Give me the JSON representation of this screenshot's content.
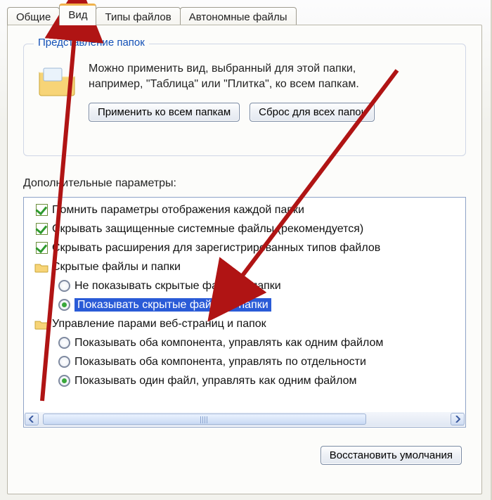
{
  "tabs": {
    "general": "Общие",
    "view": "Вид",
    "filetypes": "Типы файлов",
    "offline": "Автономные файлы"
  },
  "group": {
    "title": "Представление папок",
    "text1": "Можно применить вид, выбранный для этой папки,",
    "text2": "например, \"Таблица\" или \"Плитка\", ко всем папкам.",
    "apply_btn": "Применить ко всем папкам",
    "reset_btn": "Сброс для всех папок"
  },
  "advanced_label": "Дополнительные параметры:",
  "tree": {
    "r1": "Помнить параметры отображения каждой папки",
    "r2": "Скрывать защищенные системные файлы (рекомендуется)",
    "r3": "Скрывать расширения для зарегистрированных типов файлов",
    "g1": "Скрытые файлы и папки",
    "g1a": "Не показывать скрытые файлы и папки",
    "g1b": "Показывать скрытые файлы и папки",
    "g2": "Управление парами веб-страниц и папок",
    "g2a": "Показывать оба компонента, управлять как одним файлом",
    "g2b": "Показывать оба компонента, управлять по отдельности",
    "g2c": "Показывать один файл, управлять как одним файлом"
  },
  "restore_btn": "Восстановить умолчания"
}
